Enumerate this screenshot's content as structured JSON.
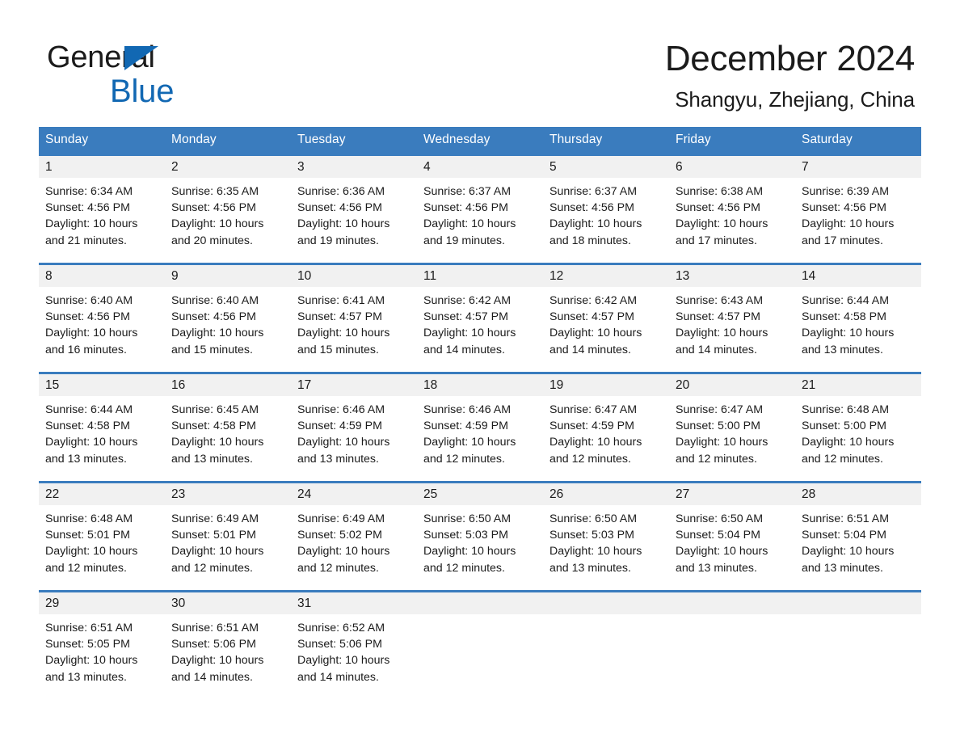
{
  "brand": {
    "name_part1": "General",
    "name_part2": "Blue",
    "logo_icon": "blue-triangle-logo",
    "accent_color": "#1268b3"
  },
  "header": {
    "month_title": "December 2024",
    "location": "Shangyu, Zhejiang, China"
  },
  "calendar": {
    "header_bg": "#3a7cbe",
    "daynum_bg": "#f1f1f1",
    "weekday_headers": [
      "Sunday",
      "Monday",
      "Tuesday",
      "Wednesday",
      "Thursday",
      "Friday",
      "Saturday"
    ],
    "weeks": [
      [
        {
          "day": "1",
          "sunrise": "Sunrise: 6:34 AM",
          "sunset": "Sunset: 4:56 PM",
          "daylight": "Daylight: 10 hours and 21 minutes."
        },
        {
          "day": "2",
          "sunrise": "Sunrise: 6:35 AM",
          "sunset": "Sunset: 4:56 PM",
          "daylight": "Daylight: 10 hours and 20 minutes."
        },
        {
          "day": "3",
          "sunrise": "Sunrise: 6:36 AM",
          "sunset": "Sunset: 4:56 PM",
          "daylight": "Daylight: 10 hours and 19 minutes."
        },
        {
          "day": "4",
          "sunrise": "Sunrise: 6:37 AM",
          "sunset": "Sunset: 4:56 PM",
          "daylight": "Daylight: 10 hours and 19 minutes."
        },
        {
          "day": "5",
          "sunrise": "Sunrise: 6:37 AM",
          "sunset": "Sunset: 4:56 PM",
          "daylight": "Daylight: 10 hours and 18 minutes."
        },
        {
          "day": "6",
          "sunrise": "Sunrise: 6:38 AM",
          "sunset": "Sunset: 4:56 PM",
          "daylight": "Daylight: 10 hours and 17 minutes."
        },
        {
          "day": "7",
          "sunrise": "Sunrise: 6:39 AM",
          "sunset": "Sunset: 4:56 PM",
          "daylight": "Daylight: 10 hours and 17 minutes."
        }
      ],
      [
        {
          "day": "8",
          "sunrise": "Sunrise: 6:40 AM",
          "sunset": "Sunset: 4:56 PM",
          "daylight": "Daylight: 10 hours and 16 minutes."
        },
        {
          "day": "9",
          "sunrise": "Sunrise: 6:40 AM",
          "sunset": "Sunset: 4:56 PM",
          "daylight": "Daylight: 10 hours and 15 minutes."
        },
        {
          "day": "10",
          "sunrise": "Sunrise: 6:41 AM",
          "sunset": "Sunset: 4:57 PM",
          "daylight": "Daylight: 10 hours and 15 minutes."
        },
        {
          "day": "11",
          "sunrise": "Sunrise: 6:42 AM",
          "sunset": "Sunset: 4:57 PM",
          "daylight": "Daylight: 10 hours and 14 minutes."
        },
        {
          "day": "12",
          "sunrise": "Sunrise: 6:42 AM",
          "sunset": "Sunset: 4:57 PM",
          "daylight": "Daylight: 10 hours and 14 minutes."
        },
        {
          "day": "13",
          "sunrise": "Sunrise: 6:43 AM",
          "sunset": "Sunset: 4:57 PM",
          "daylight": "Daylight: 10 hours and 14 minutes."
        },
        {
          "day": "14",
          "sunrise": "Sunrise: 6:44 AM",
          "sunset": "Sunset: 4:58 PM",
          "daylight": "Daylight: 10 hours and 13 minutes."
        }
      ],
      [
        {
          "day": "15",
          "sunrise": "Sunrise: 6:44 AM",
          "sunset": "Sunset: 4:58 PM",
          "daylight": "Daylight: 10 hours and 13 minutes."
        },
        {
          "day": "16",
          "sunrise": "Sunrise: 6:45 AM",
          "sunset": "Sunset: 4:58 PM",
          "daylight": "Daylight: 10 hours and 13 minutes."
        },
        {
          "day": "17",
          "sunrise": "Sunrise: 6:46 AM",
          "sunset": "Sunset: 4:59 PM",
          "daylight": "Daylight: 10 hours and 13 minutes."
        },
        {
          "day": "18",
          "sunrise": "Sunrise: 6:46 AM",
          "sunset": "Sunset: 4:59 PM",
          "daylight": "Daylight: 10 hours and 12 minutes."
        },
        {
          "day": "19",
          "sunrise": "Sunrise: 6:47 AM",
          "sunset": "Sunset: 4:59 PM",
          "daylight": "Daylight: 10 hours and 12 minutes."
        },
        {
          "day": "20",
          "sunrise": "Sunrise: 6:47 AM",
          "sunset": "Sunset: 5:00 PM",
          "daylight": "Daylight: 10 hours and 12 minutes."
        },
        {
          "day": "21",
          "sunrise": "Sunrise: 6:48 AM",
          "sunset": "Sunset: 5:00 PM",
          "daylight": "Daylight: 10 hours and 12 minutes."
        }
      ],
      [
        {
          "day": "22",
          "sunrise": "Sunrise: 6:48 AM",
          "sunset": "Sunset: 5:01 PM",
          "daylight": "Daylight: 10 hours and 12 minutes."
        },
        {
          "day": "23",
          "sunrise": "Sunrise: 6:49 AM",
          "sunset": "Sunset: 5:01 PM",
          "daylight": "Daylight: 10 hours and 12 minutes."
        },
        {
          "day": "24",
          "sunrise": "Sunrise: 6:49 AM",
          "sunset": "Sunset: 5:02 PM",
          "daylight": "Daylight: 10 hours and 12 minutes."
        },
        {
          "day": "25",
          "sunrise": "Sunrise: 6:50 AM",
          "sunset": "Sunset: 5:03 PM",
          "daylight": "Daylight: 10 hours and 12 minutes."
        },
        {
          "day": "26",
          "sunrise": "Sunrise: 6:50 AM",
          "sunset": "Sunset: 5:03 PM",
          "daylight": "Daylight: 10 hours and 13 minutes."
        },
        {
          "day": "27",
          "sunrise": "Sunrise: 6:50 AM",
          "sunset": "Sunset: 5:04 PM",
          "daylight": "Daylight: 10 hours and 13 minutes."
        },
        {
          "day": "28",
          "sunrise": "Sunrise: 6:51 AM",
          "sunset": "Sunset: 5:04 PM",
          "daylight": "Daylight: 10 hours and 13 minutes."
        }
      ],
      [
        {
          "day": "29",
          "sunrise": "Sunrise: 6:51 AM",
          "sunset": "Sunset: 5:05 PM",
          "daylight": "Daylight: 10 hours and 13 minutes."
        },
        {
          "day": "30",
          "sunrise": "Sunrise: 6:51 AM",
          "sunset": "Sunset: 5:06 PM",
          "daylight": "Daylight: 10 hours and 14 minutes."
        },
        {
          "day": "31",
          "sunrise": "Sunrise: 6:52 AM",
          "sunset": "Sunset: 5:06 PM",
          "daylight": "Daylight: 10 hours and 14 minutes."
        },
        {
          "day": "",
          "sunrise": "",
          "sunset": "",
          "daylight": ""
        },
        {
          "day": "",
          "sunrise": "",
          "sunset": "",
          "daylight": ""
        },
        {
          "day": "",
          "sunrise": "",
          "sunset": "",
          "daylight": ""
        },
        {
          "day": "",
          "sunrise": "",
          "sunset": "",
          "daylight": ""
        }
      ]
    ]
  }
}
